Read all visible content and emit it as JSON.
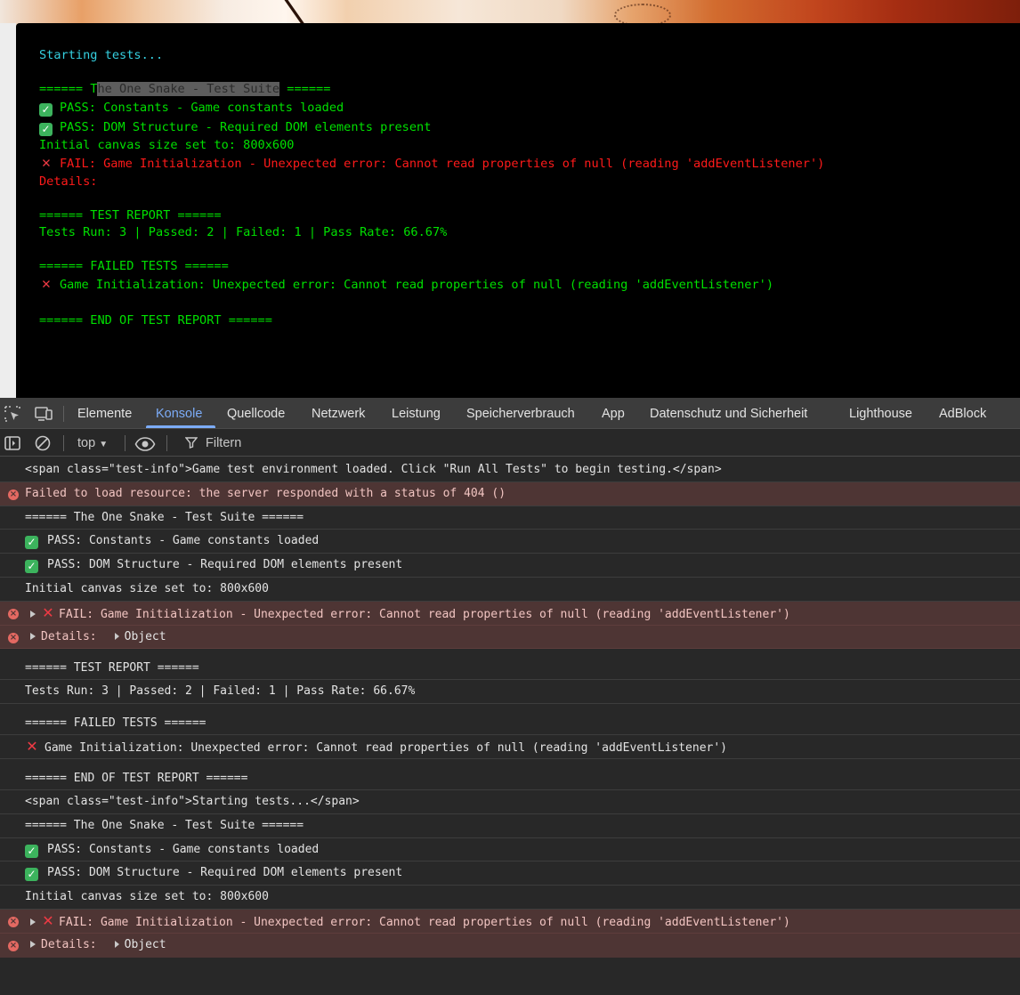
{
  "page": {
    "output_lines": {
      "starting": "Starting tests...",
      "suite_pre": "====== T",
      "suite_sel": "he One Snake - Test Suite",
      "suite_post": " ======",
      "pass1": "PASS: Constants - Game constants loaded",
      "pass2": "PASS: DOM Structure - Required DOM elements present",
      "canvas": "Initial canvas size set to: 800x600",
      "fail": "FAIL: Game Initialization - Unexpected error: Cannot read properties of null (reading 'addEventListener')",
      "details": "Details:",
      "report_head": "====== TEST REPORT ======",
      "report_stats": "Tests Run: 3 | Passed: 2 | Failed: 1 | Pass Rate: 66.67%",
      "failed_head": "====== FAILED TESTS ======",
      "failed_item": "Game Initialization: Unexpected error: Cannot read properties of null (reading 'addEventListener')",
      "end": "====== END OF TEST REPORT ======"
    }
  },
  "devtools": {
    "tabs": [
      "Elemente",
      "Konsole",
      "Quellcode",
      "Netzwerk",
      "Leistung",
      "Speicherverbrauch",
      "App",
      "Datenschutz und Sicherheit",
      "Lighthouse",
      "AdBlock"
    ],
    "active_tab": "Konsole",
    "toolbar": {
      "context": "top",
      "filter_placeholder": "Filtern"
    },
    "console": {
      "l1": "<span class=\"test-info\">Game test environment loaded. Click \"Run All Tests\" to begin testing.</span>",
      "l2": "Failed to load resource: the server responded with a status of 404 ()",
      "l3": "====== The One Snake - Test Suite ======",
      "l4": "PASS: Constants - Game constants loaded",
      "l5": "PASS: DOM Structure - Required DOM elements present",
      "l6": "Initial canvas size set to: 800x600",
      "l7": "FAIL: Game Initialization - Unexpected error: Cannot read properties of null (reading 'addEventListener')",
      "l8": "Details:",
      "l8_obj": "Object",
      "l9": "====== TEST REPORT ======",
      "l10": "Tests Run: 3 | Passed: 2 | Failed: 1 | Pass Rate: 66.67%",
      "l11": "====== FAILED TESTS ======",
      "l12": "Game Initialization: Unexpected error: Cannot read properties of null (reading 'addEventListener')",
      "l13": "====== END OF TEST REPORT ======",
      "l14": "<span class=\"test-info\">Starting tests...</span>",
      "l15": "====== The One Snake - Test Suite ======",
      "l16": "PASS: Constants - Game constants loaded",
      "l17": "PASS: DOM Structure - Required DOM elements present",
      "l18": "Initial canvas size set to: 800x600",
      "l19": "FAIL: Game Initialization - Unexpected error: Cannot read properties of null (reading 'addEventListener')",
      "l20": "Details:",
      "l20_obj": "Object"
    }
  },
  "colors": {
    "terminal_green": "#00e000",
    "terminal_cyan": "#35d0e0",
    "terminal_red": "#ff1a1a",
    "devtools_accent": "#7cacf8",
    "error_row_bg": "#4e3534"
  }
}
